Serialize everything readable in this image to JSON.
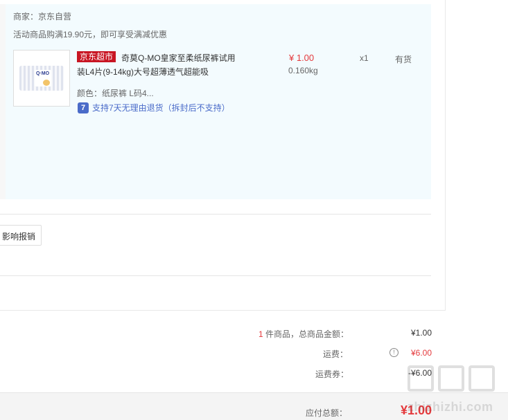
{
  "order": {
    "merchant": "商家：京东自营",
    "promo": "活动商品购满19.90元，即可享受满减优惠",
    "item": {
      "tag": "京东超市",
      "title": "奇莫Q-MO皇家至柔纸尿裤试用装L4片(9-14kg)大号超薄透气超能吸",
      "spec": "颜色：纸尿裤 L码4...",
      "return_policy": "支持7天无理由退货（拆封后不支持）",
      "return_icon": "7",
      "price": "¥ 1.00",
      "weight": "0.160kg",
      "quantity": "x1",
      "stock": "有货",
      "image_logo": "Q·MO"
    },
    "invoice_button": "影响报销"
  },
  "summary": {
    "count": "1",
    "count_label": "件商品，总商品金额：",
    "amount": "¥1.00",
    "shipping_label": "运费：",
    "shipping_amount": "¥6.00",
    "coupon_label": "运费券：",
    "coupon_amount": "-¥6.00",
    "total_label": "应付总额：",
    "total_amount": "¥1.00"
  },
  "watermark": "zhizhizhi.com",
  "colors": {
    "accent": "#e4393c",
    "tag_red": "#c81623",
    "link_blue": "#4a6bc9",
    "panel_bg": "#f3fbfe"
  }
}
